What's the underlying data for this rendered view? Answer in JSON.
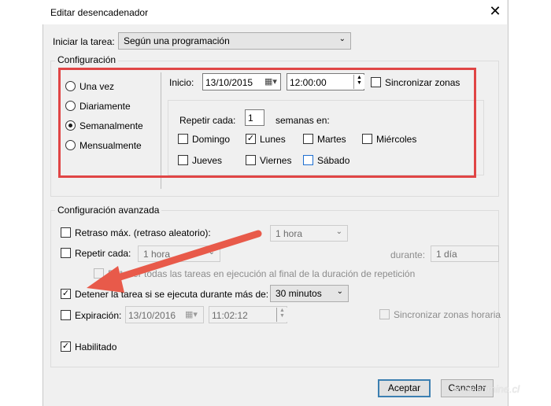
{
  "window": {
    "title": "Editar desencadenador",
    "close_glyph": "✕"
  },
  "start_task": {
    "label": "Iniciar la tarea:",
    "value": "Según una programación"
  },
  "config": {
    "group_label": "Configuración",
    "radios": [
      {
        "label": "Una vez",
        "selected": false
      },
      {
        "label": "Diariamente",
        "selected": false
      },
      {
        "label": "Semanalmente",
        "selected": true
      },
      {
        "label": "Mensualmente",
        "selected": false
      }
    ],
    "start_label": "Inicio:",
    "start_date": "13/10/2015",
    "start_time": "12:00:00",
    "sync_zones_label": "Sincronizar zonas",
    "repeat_every_label": "Repetir cada:",
    "repeat_every_value": "1",
    "weeks_on_label": "semanas en:",
    "days": [
      {
        "label": "Domingo",
        "checked": false
      },
      {
        "label": "Lunes",
        "checked": true
      },
      {
        "label": "Martes",
        "checked": false
      },
      {
        "label": "Miércoles",
        "checked": false
      },
      {
        "label": "Jueves",
        "checked": false
      },
      {
        "label": "Viernes",
        "checked": false
      },
      {
        "label": "Sábado",
        "checked": false
      }
    ]
  },
  "advanced": {
    "group_label": "Configuración avanzada",
    "delay_label": "Retraso máx. (retraso aleatorio):",
    "delay_value": "1 hora",
    "repeat_label": "Repetir cada:",
    "repeat_value": "1 hora",
    "duration_label": "durante:",
    "duration_value": "1 día",
    "stop_all_label": "Detener todas las tareas en ejecución al final de la duración de repetición",
    "stop_if_label": "Detener la tarea si se ejecuta durante más de:",
    "stop_if_value": "30 minutos",
    "expire_label": "Expiración:",
    "expire_date": "13/10/2016",
    "expire_time": "11:02:12",
    "expire_sync_label": "Sincronizar zonas horaria",
    "enabled_label": "Habilitado"
  },
  "buttons": {
    "ok": "Aceptar",
    "cancel": "Cancelar"
  },
  "watermark": "www.sdmine.cl",
  "colors": {
    "highlight_box": "#e04545",
    "arrow": "#e85a4a"
  }
}
